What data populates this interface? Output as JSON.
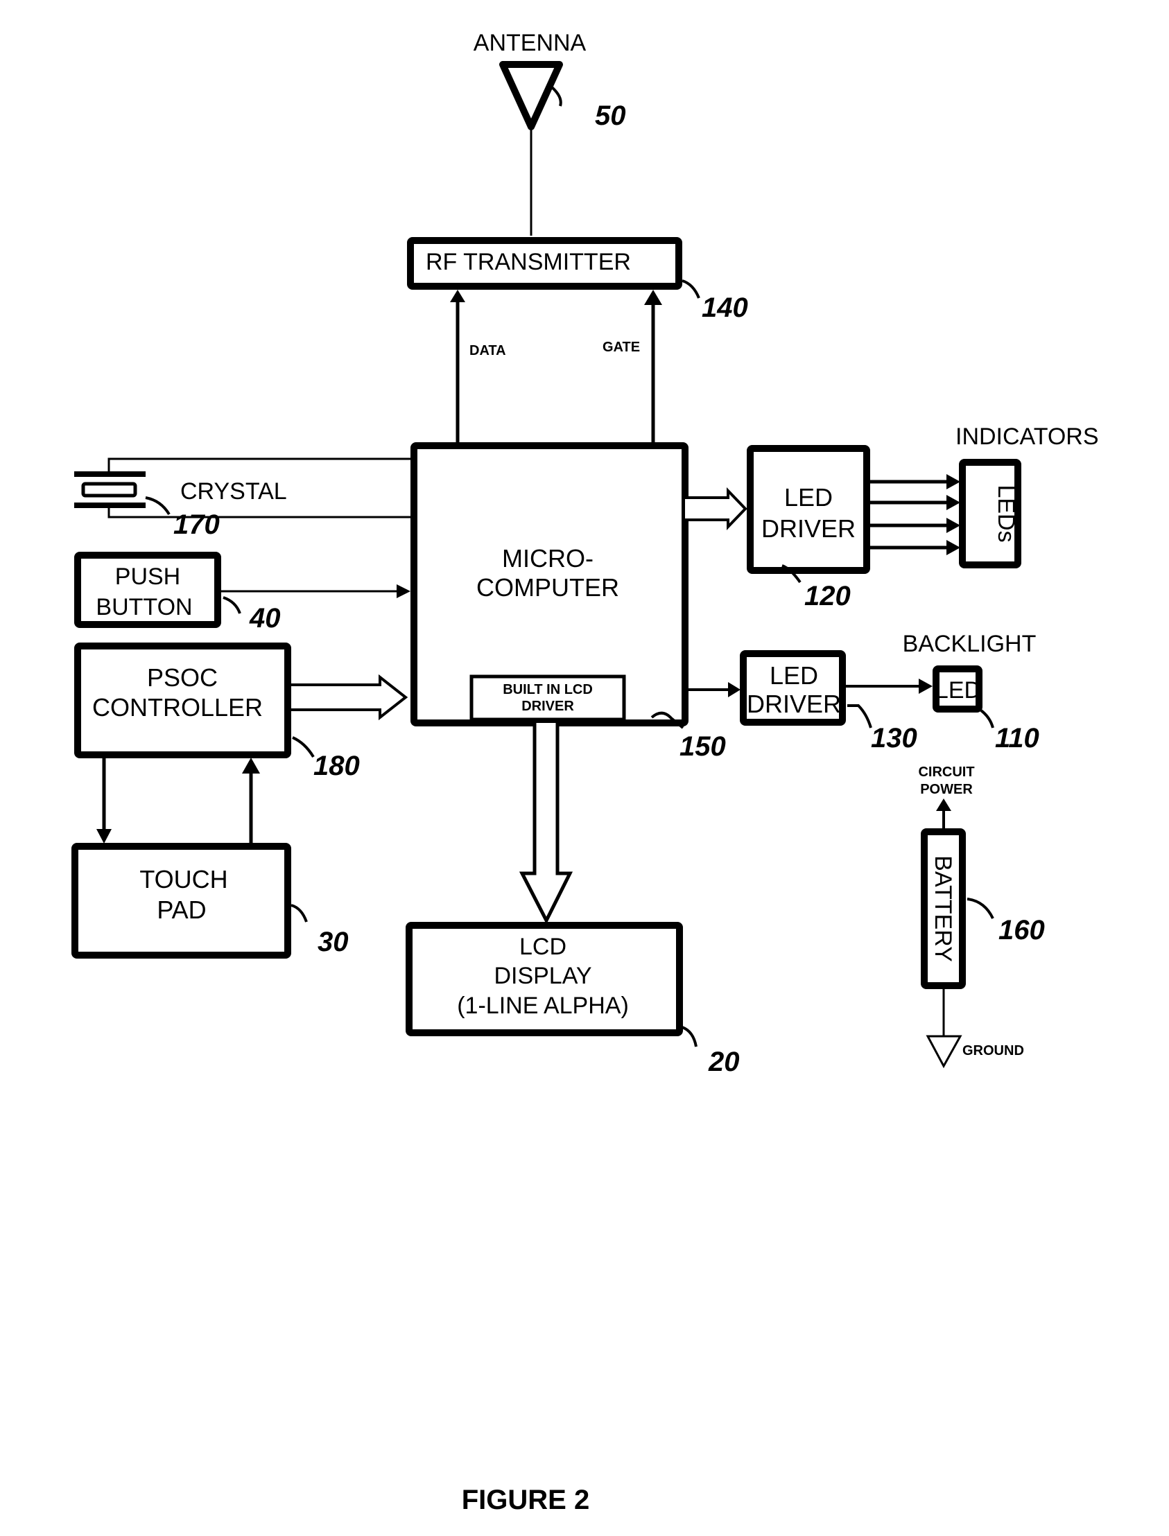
{
  "figure": {
    "caption": "FIGURE 2"
  },
  "blocks": {
    "antenna": {
      "label": "ANTENNA",
      "ref": "50"
    },
    "rf_transmitter": {
      "label": "RF TRANSMITTER",
      "ref": "140"
    },
    "microcomputer": {
      "line1": "MICRO-",
      "line2": "COMPUTER",
      "ref": "150"
    },
    "lcd_driver": {
      "line1": "BUILT IN LCD",
      "line2": "DRIVER"
    },
    "crystal": {
      "label": "CRYSTAL",
      "ref": "170"
    },
    "push_button": {
      "line1": "PUSH",
      "line2": "BUTTON",
      "ref": "40"
    },
    "psoc": {
      "line1": "PSOC",
      "line2": "CONTROLLER",
      "ref": "180"
    },
    "touch_pad": {
      "line1": "TOUCH",
      "line2": "PAD",
      "ref": "30"
    },
    "lcd_display": {
      "line1": "LCD",
      "line2": "DISPLAY",
      "line3": "(1-LINE ALPHA)",
      "ref": "20"
    },
    "led_driver_1": {
      "line1": "LED",
      "line2": "DRIVER",
      "ref": "120"
    },
    "indicators": {
      "title": "INDICATORS",
      "label": "LEDs"
    },
    "led_driver_2": {
      "line1": "LED",
      "line2": "DRIVER",
      "ref": "130"
    },
    "backlight": {
      "title": "BACKLIGHT",
      "label": "LED",
      "ref": "110"
    },
    "battery": {
      "label": "BATTERY",
      "ref": "160",
      "power_line1": "CIRCUIT",
      "power_line2": "POWER",
      "ground": "GROUND"
    }
  },
  "signals": {
    "data": "DATA",
    "gate": "GATE"
  }
}
